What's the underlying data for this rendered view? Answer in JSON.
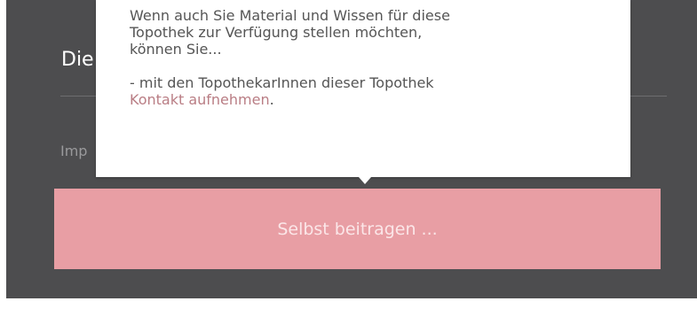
{
  "section": {
    "heading": "Die",
    "impressum_label": "Imp"
  },
  "cta": {
    "label": "Selbst beitragen ..."
  },
  "popover": {
    "intro_line1": "Wenn auch Sie Material und Wissen für diese",
    "intro_line2": "Topothek zur Verfügung stellen möchten,",
    "intro_line3": "können Sie...",
    "option_text": "- mit den TopothekarInnen dieser Topothek",
    "option_link": "Kontakt aufnehmen",
    "option_suffix": "."
  },
  "colors": {
    "panel_bg": "#4d4d4f",
    "accent": "#e89ea4",
    "link": "#b97d84"
  }
}
